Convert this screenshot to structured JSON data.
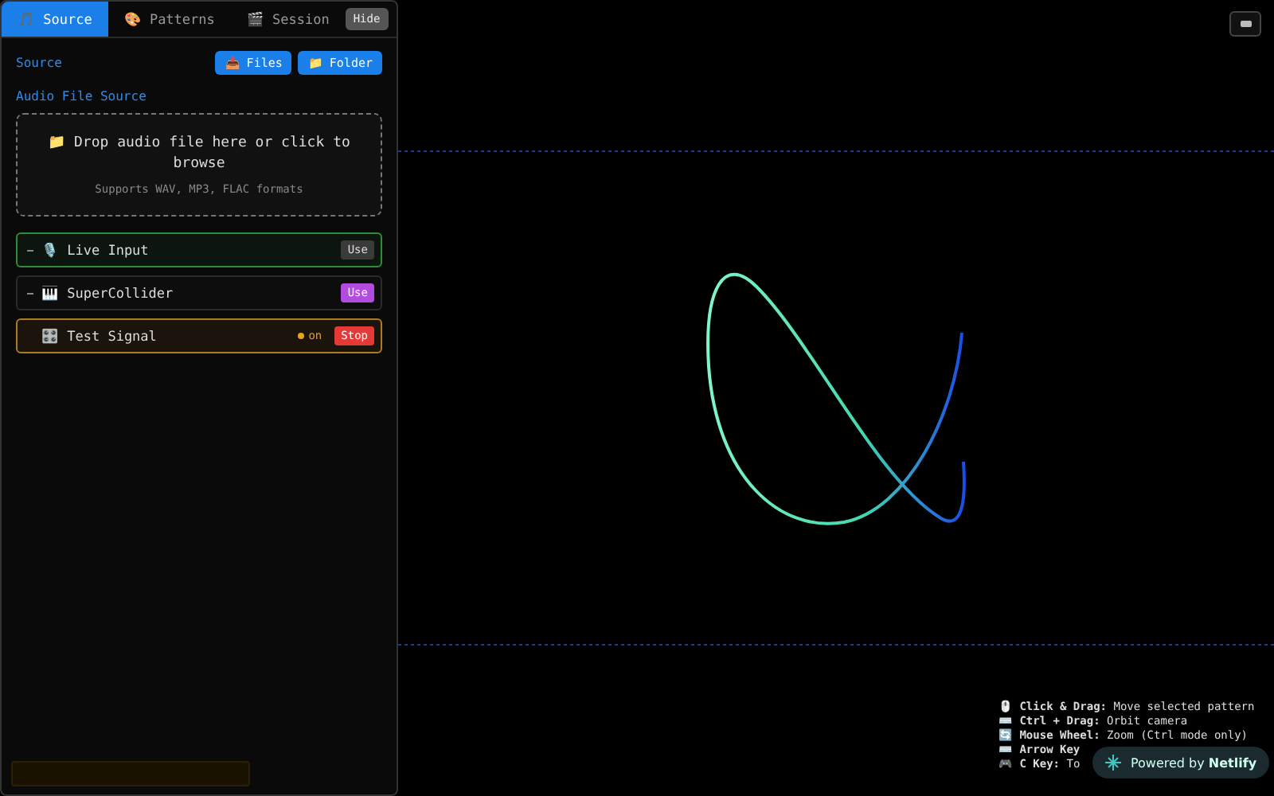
{
  "sidebar": {
    "tabs": [
      {
        "icon": "🎵",
        "label": "Source",
        "selected": true
      },
      {
        "icon": "🎨",
        "label": "Patterns",
        "selected": false
      },
      {
        "icon": "🎬",
        "label": "Session",
        "selected": false
      }
    ],
    "hide_button": "Hide",
    "section_title": "Source",
    "actions": [
      {
        "icon": "📥",
        "label": "Files"
      },
      {
        "icon": "📁",
        "label": "Folder"
      }
    ],
    "file_source": {
      "title": "Audio File Source",
      "prompt": "📁 Drop audio file here or click to browse",
      "hint": "Supports WAV, MP3, FLAC formats"
    },
    "sources": [
      {
        "kind": "input",
        "icon": "🎙️",
        "label": "Live Input",
        "button": "Use",
        "color": "#2e8b3a"
      },
      {
        "kind": "synth",
        "icon": "🎹",
        "label": "SuperCollider",
        "button": "Use",
        "color": "#2a2a2a"
      },
      {
        "kind": "signal",
        "icon": "🎛️",
        "label": "Test Signal",
        "status": "on",
        "button": "Stop",
        "color": "#b07a1e"
      }
    ]
  },
  "viewport": {
    "help": [
      {
        "icon": "🖱️",
        "key": "Click & Drag:",
        "text": "Move selected pattern"
      },
      {
        "icon": "⌨️",
        "key": "Ctrl + Drag:",
        "text": "Orbit camera"
      },
      {
        "icon": "🔄",
        "key": "Mouse Wheel:",
        "text": "Zoom (Ctrl mode only)"
      },
      {
        "icon": "⌨️",
        "key": "Arrow Key"
      },
      {
        "icon": "🎮",
        "key": "C Key:",
        "text": "To"
      }
    ],
    "badge": {
      "prefix": "Powered by",
      "brand": "Netlify"
    }
  }
}
